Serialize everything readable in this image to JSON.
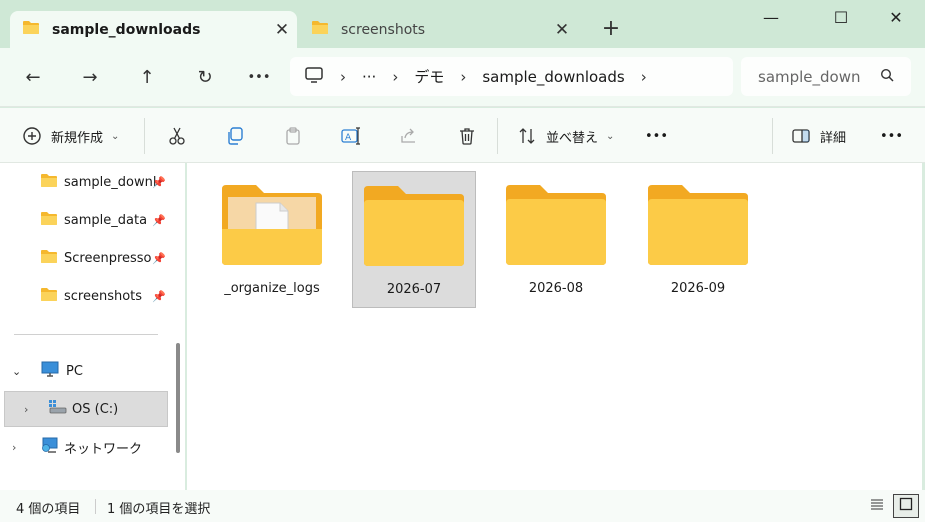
{
  "tabs": [
    {
      "label": "sample_downloads",
      "active": true
    },
    {
      "label": "screenshots",
      "active": false
    }
  ],
  "window": {
    "new_tab": "+",
    "minimize": "—",
    "maximize": "☐",
    "close": "✕"
  },
  "nav": {
    "back": "←",
    "forward": "→",
    "up": "↑",
    "refresh": "↻",
    "more": "•••"
  },
  "address": {
    "more": "···",
    "crumbs": [
      "デモ",
      "sample_downloads"
    ],
    "separator": "›"
  },
  "search": {
    "placeholder": "sample_down"
  },
  "commands": {
    "new_label": "新規作成",
    "sort_label": "並べ替え",
    "details_label": "詳細",
    "more": "•••"
  },
  "sidebar": {
    "quick_access": [
      {
        "label": "sample_downl",
        "pinned": true
      },
      {
        "label": "sample_data",
        "pinned": true
      },
      {
        "label": "Screenpresso",
        "pinned": true
      },
      {
        "label": "screenshots",
        "pinned": true
      }
    ],
    "pc": "PC",
    "drive": "OS (C:)",
    "network": "ネットワーク"
  },
  "folders": [
    {
      "name": "_organize_logs",
      "has_file": true,
      "selected": false
    },
    {
      "name": "2026-07",
      "has_file": false,
      "selected": true
    },
    {
      "name": "2026-08",
      "has_file": false,
      "selected": false
    },
    {
      "name": "2026-09",
      "has_file": false,
      "selected": false
    }
  ],
  "status": {
    "item_count": "4 個の項目",
    "selected": "1 個の項目を選択"
  },
  "colors": {
    "accent": "#cfe8d6",
    "folder": "#f8c93c",
    "folder_light": "#fde38a"
  }
}
